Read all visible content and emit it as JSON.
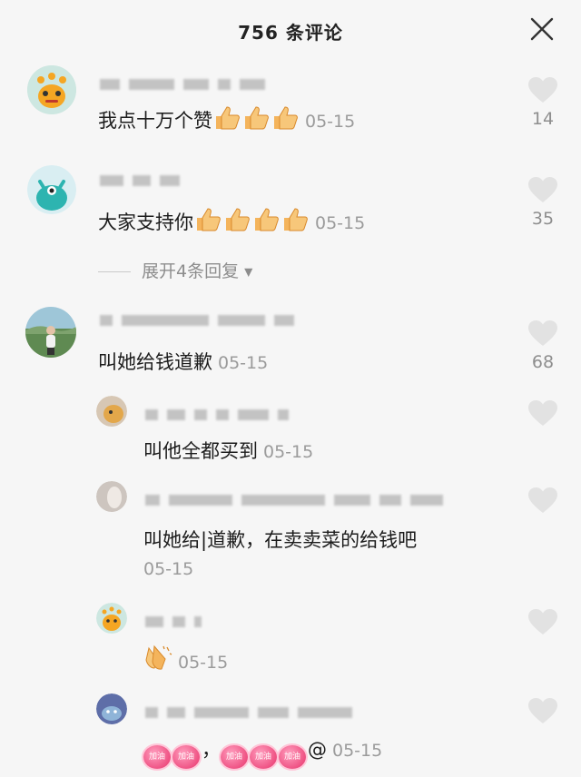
{
  "header": {
    "title": "756 条评论"
  },
  "comments": [
    {
      "text": "我点十万个赞",
      "emoji": [
        "thumbs-up",
        "thumbs-up",
        "thumbs-up"
      ],
      "time": "05-15",
      "likes": "14"
    },
    {
      "text": "大家支持你",
      "emoji": [
        "thumbs-up",
        "thumbs-up",
        "thumbs-up",
        "thumbs-up"
      ],
      "time": "05-15",
      "likes": "35"
    },
    {
      "text": "叫她给钱道歉",
      "time": "05-15",
      "likes": "68"
    }
  ],
  "expand_label": "展开4条回复",
  "replies": [
    {
      "text": "叫他全都买到",
      "time": "05-15"
    },
    {
      "text": "叫她给|道歉，在卖卖菜的给钱吧",
      "time": "05-15"
    },
    {
      "emoji": [
        "clapping-hands"
      ],
      "time": "05-15"
    },
    {
      "badge_text": "加油",
      "separator": "，",
      "mention": "@",
      "time": "05-15"
    }
  ],
  "colors": {
    "background": "#f6f6f6",
    "muted": "#9b9b9b",
    "like_icon": "#e2e2e2"
  }
}
